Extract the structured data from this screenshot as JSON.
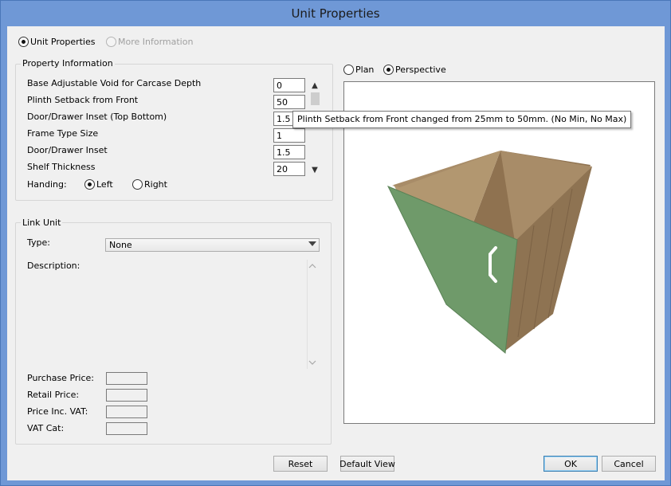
{
  "window": {
    "title": "Unit Properties"
  },
  "tabs": [
    {
      "label": "Unit Properties",
      "selected": true
    },
    {
      "label": "More Information",
      "selected": false,
      "disabled": true
    }
  ],
  "property_information": {
    "title": "Property Information",
    "rows": [
      {
        "label": "Base Adjustable Void for Carcase Depth",
        "value": "0"
      },
      {
        "label": "Plinth Setback from Front",
        "value": "50"
      },
      {
        "label": "Door/Drawer Inset (Top  Bottom)",
        "value": "1.5"
      },
      {
        "label": "Frame Type Size",
        "value": "1"
      },
      {
        "label": "Door/Drawer Inset",
        "value": "1.5"
      },
      {
        "label": "Shelf Thickness",
        "value": "20"
      }
    ],
    "handing": {
      "label": "Handing:",
      "options": [
        {
          "label": "Left",
          "selected": true
        },
        {
          "label": "Right",
          "selected": false
        }
      ]
    },
    "scroll_up": "▲",
    "scroll_down": "▼"
  },
  "tooltip": {
    "text": "Plinth Setback from Front changed from 25mm to 50mm.  (No Min, No Max)"
  },
  "link_unit": {
    "title": "Link Unit",
    "type_label": "Type:",
    "type_value": "None",
    "description_label": "Description:",
    "prices": [
      {
        "label": "Purchase Price:",
        "value": ""
      },
      {
        "label": "Retail Price:",
        "value": ""
      },
      {
        "label": "Price Inc. VAT:",
        "value": ""
      },
      {
        "label": "VAT Cat:",
        "value": ""
      }
    ]
  },
  "view_mode": {
    "options": [
      {
        "label": "Plan",
        "selected": false
      },
      {
        "label": "Perspective",
        "selected": true
      }
    ]
  },
  "buttons": {
    "reset": "Reset",
    "default_view": "Default View",
    "ok": "OK",
    "cancel": "Cancel"
  },
  "colors": {
    "title_bar": "#6f98d6",
    "dialog_bg": "#f0f0f0",
    "door_green": "#6f9a6a",
    "wood": "#9c7f5c"
  }
}
